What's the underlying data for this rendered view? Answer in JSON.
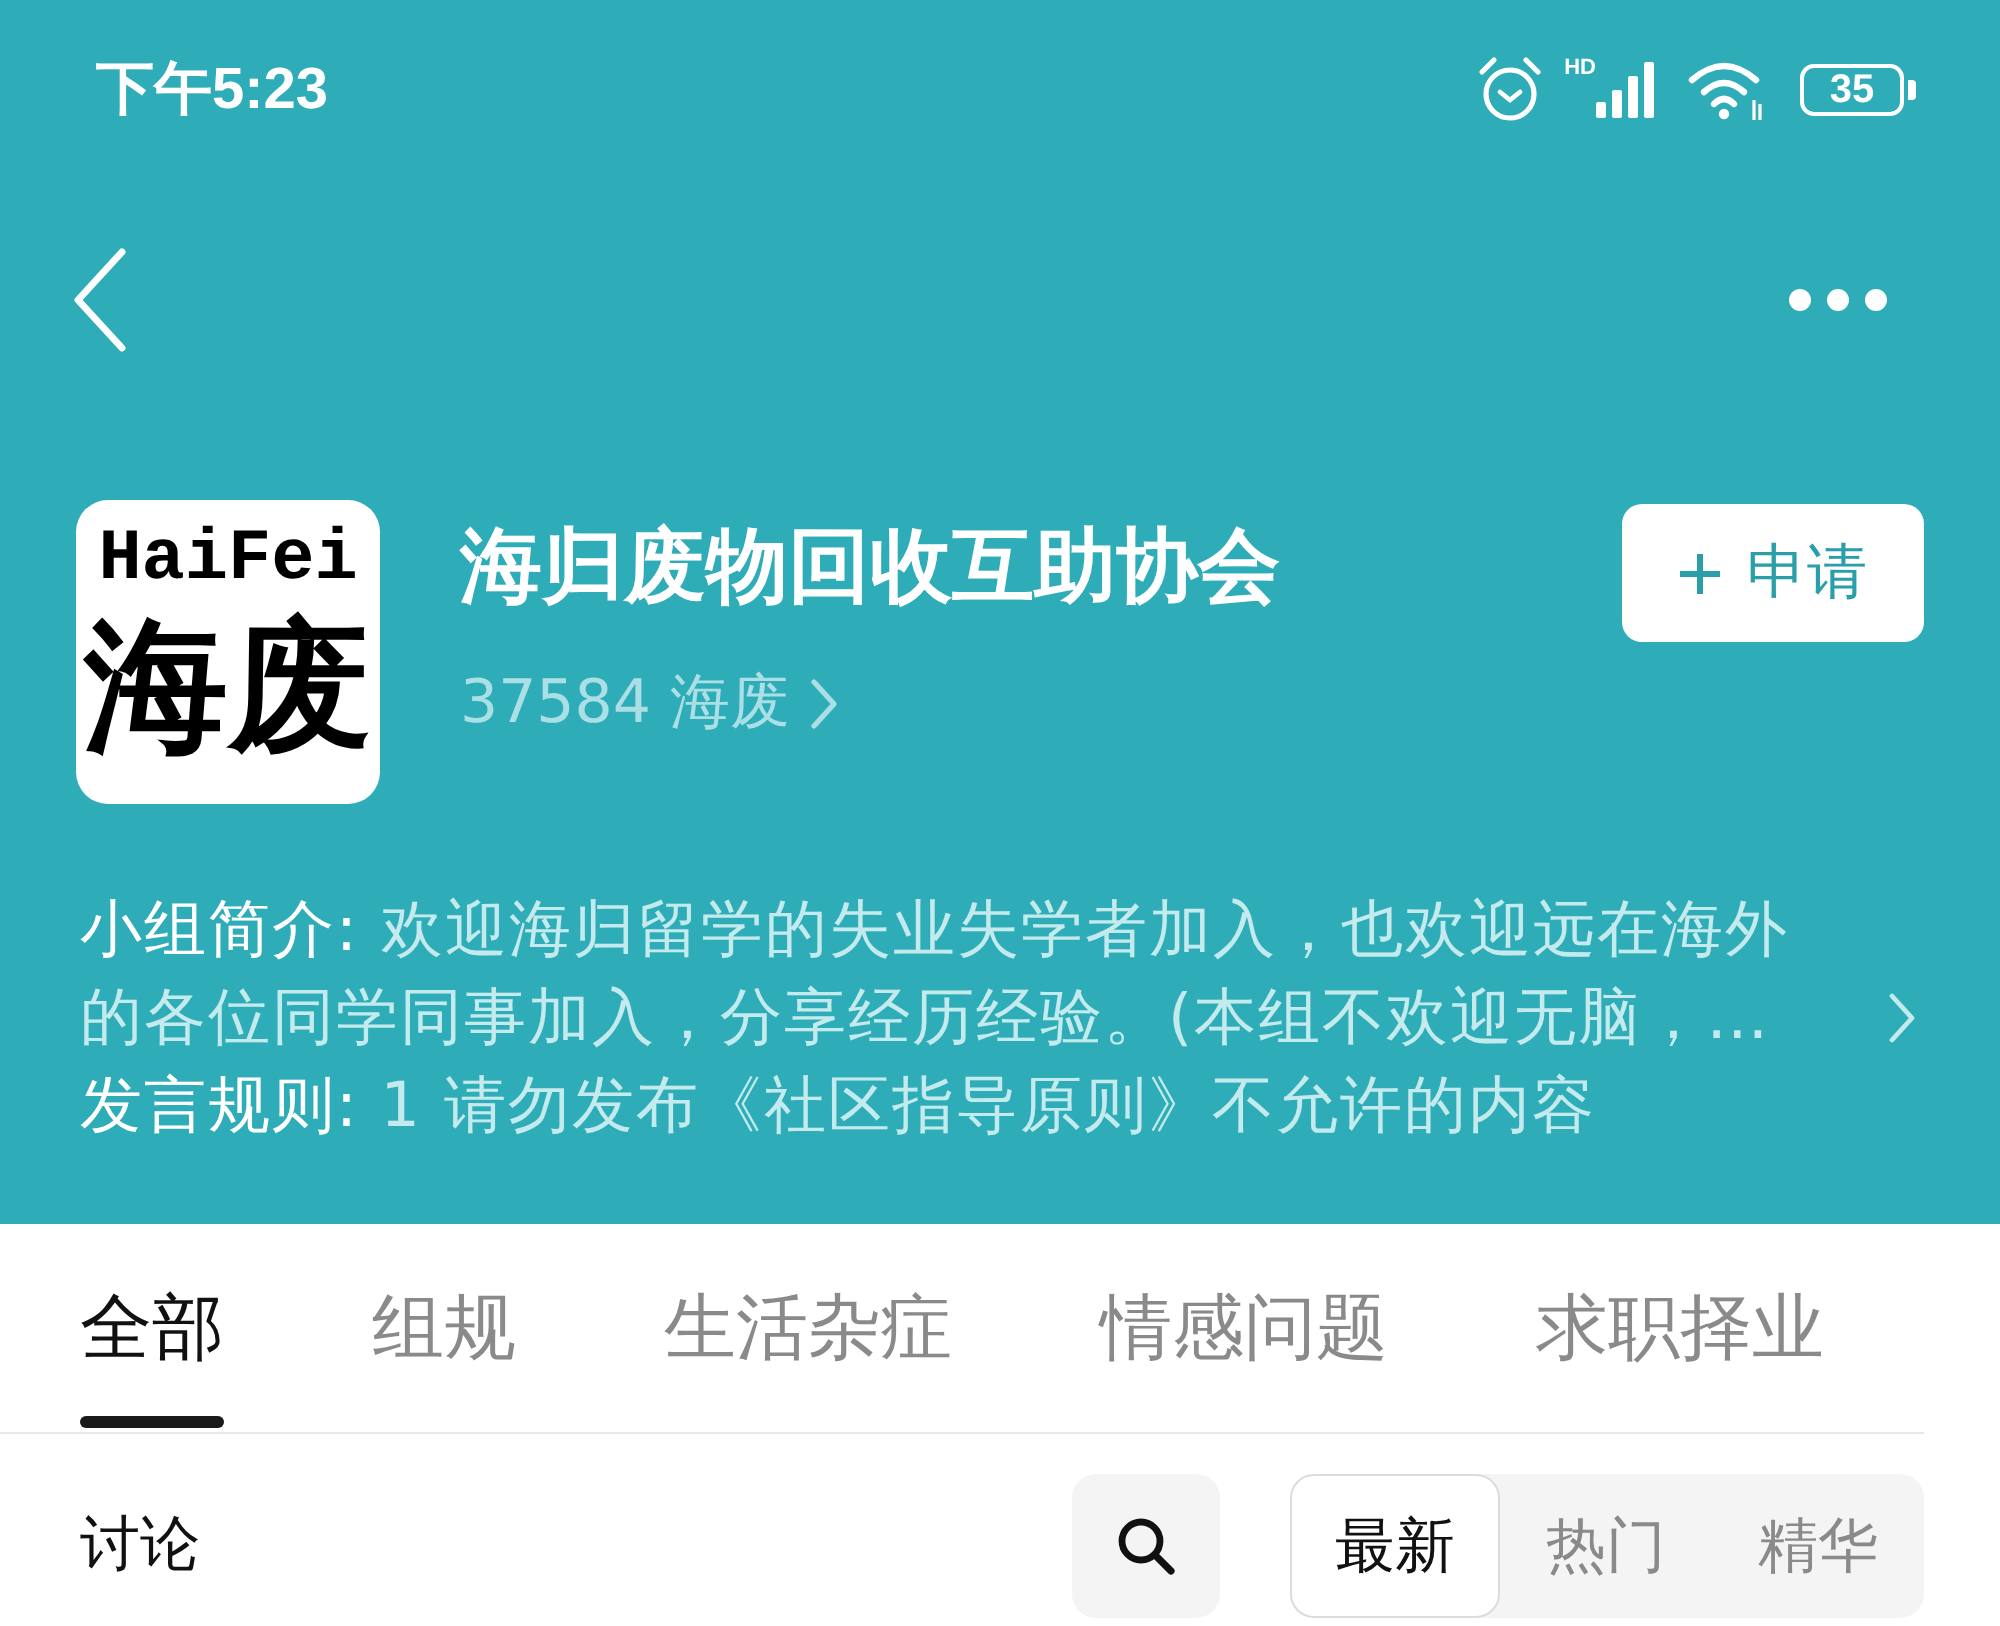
{
  "status_bar": {
    "time": "下午5:23",
    "network_badge": "HD",
    "battery": "35"
  },
  "group": {
    "logo_top": "HaiFei",
    "logo_bottom": "海废",
    "name": "海归废物回收互助协会",
    "members": "37584 海废",
    "apply_button": "申请"
  },
  "intro": "**小组简介:** 欢迎海归留学的失业失学者加入，也欢迎远在海外的各位同学同事加入，分享经历经验。(本组不欢迎无脑，…",
  "rules": "**发言规则:** 1 请勿发布《社区指导原则》不允许的内容",
  "tabs": [
    {
      "label": "全部",
      "selected": true
    },
    {
      "label": "组规",
      "selected": false
    },
    {
      "label": "生活杂症",
      "selected": false
    },
    {
      "label": "情感问题",
      "selected": false
    },
    {
      "label": "求职择业",
      "selected": false
    }
  ],
  "discussion": {
    "title": "讨论",
    "sort_options": [
      {
        "label": "最新",
        "selected": true
      },
      {
        "label": "热门",
        "selected": false
      },
      {
        "label": "精华",
        "selected": false
      }
    ]
  }
}
